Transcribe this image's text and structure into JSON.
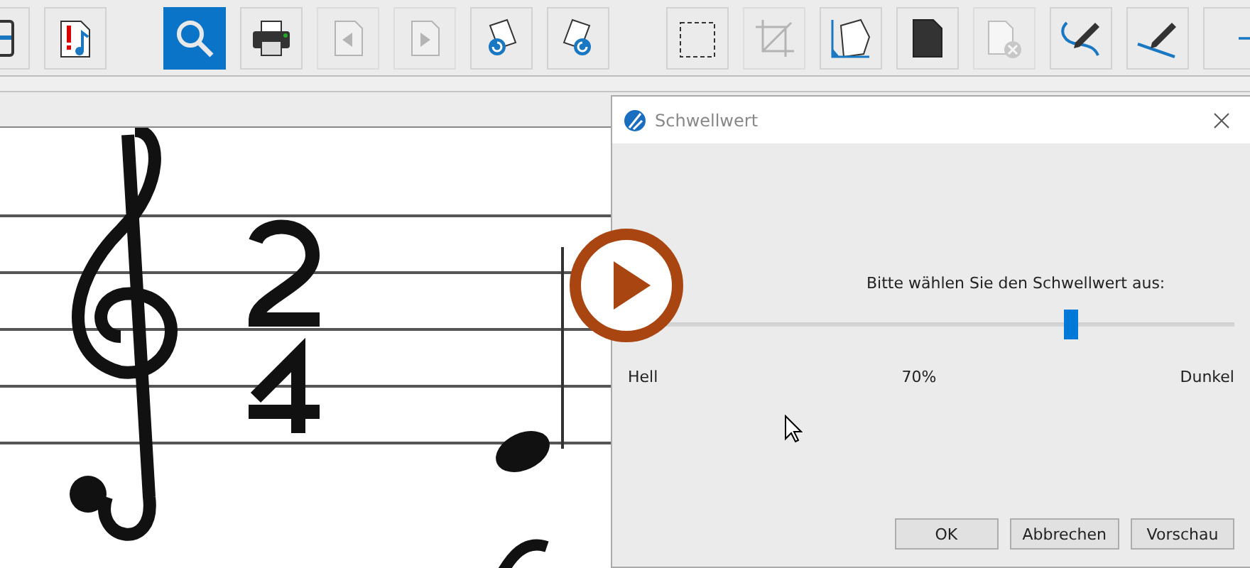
{
  "toolbar": {
    "groups": [
      [
        {
          "selected": false,
          "disabled": false
        },
        {
          "selected": false,
          "disabled": false
        }
      ],
      [
        {
          "selected": true,
          "disabled": false
        },
        {
          "selected": false,
          "disabled": false
        },
        {
          "selected": false,
          "disabled": true
        },
        {
          "selected": false,
          "disabled": true
        },
        {
          "selected": false,
          "disabled": false
        },
        {
          "selected": false,
          "disabled": false
        }
      ],
      [
        {
          "selected": false,
          "disabled": false
        },
        {
          "selected": false,
          "disabled": true
        },
        {
          "selected": false,
          "disabled": false
        },
        {
          "selected": false,
          "disabled": false
        },
        {
          "selected": false,
          "disabled": true
        },
        {
          "selected": false,
          "disabled": false
        },
        {
          "selected": false,
          "disabled": false
        },
        {
          "selected": false,
          "disabled": false
        }
      ]
    ]
  },
  "dialog": {
    "title": "Schwellwert",
    "prompt": "Bitte wählen Sie den Schwellwert aus:",
    "slider": {
      "level": 0.7,
      "min_label": "Hell",
      "reading": "70%",
      "max_label": "Dunkel"
    },
    "buttons": [
      "OK",
      "Abbrechen",
      "Vorschau"
    ]
  }
}
